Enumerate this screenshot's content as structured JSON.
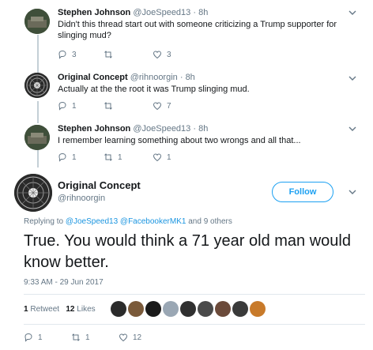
{
  "thread": [
    {
      "name": "Stephen Johnson",
      "handle": "@JoeSpeed13",
      "time": "· 8h",
      "text": "Didn't this thread start out with someone criticizing a Trump supporter for slinging mud?",
      "replies": "3",
      "retweets": "",
      "likes": "3"
    },
    {
      "name": "Original Concept",
      "handle": "@rihnoorgin",
      "time": "· 8h",
      "text": "Actually at the the root it was Trump slinging mud.",
      "replies": "1",
      "retweets": "",
      "likes": "7"
    },
    {
      "name": "Stephen Johnson",
      "handle": "@JoeSpeed13",
      "time": "· 8h",
      "text": "I remember learning something about two wrongs and all that...",
      "replies": "1",
      "retweets": "1",
      "likes": "1"
    }
  ],
  "focus": {
    "name": "Original Concept",
    "handle": "@rihnoorgin",
    "follow_label": "Follow",
    "replying_prefix": "Replying to",
    "replying_user1": "@JoeSpeed13",
    "replying_user2": "@FacebookerMK1",
    "replying_suffix": "and 9 others",
    "text": "True. You would think a 71 year old man would know better.",
    "datetime": "9:33 AM - 29 Jun 2017",
    "retweet_count": "1",
    "retweet_label": "Retweet",
    "like_count": "12",
    "like_label": "Likes",
    "replies": "1",
    "retweets": "1",
    "likes": "12"
  },
  "colors": {
    "accent": "#1da1f2",
    "muted": "#657786",
    "text": "#14171a"
  },
  "likers": [
    "#2b2b2b",
    "#7a5a3a",
    "#1a1a1a",
    "#9aa7b4",
    "#303030",
    "#4a4a4a",
    "#6b4a3a",
    "#3a3a3a",
    "#c87a2a"
  ]
}
